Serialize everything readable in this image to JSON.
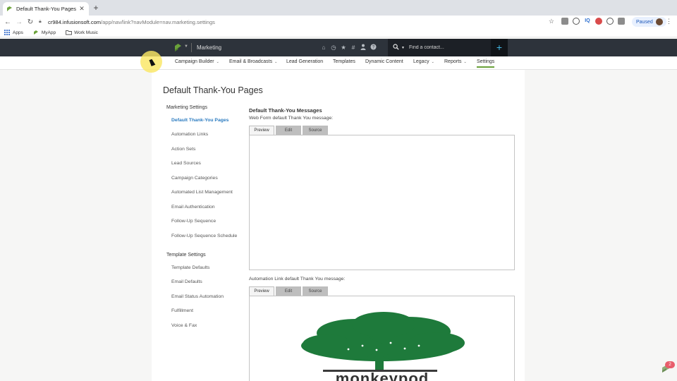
{
  "browser": {
    "tab_title": "Default Thank-You Pages",
    "new_tab_symbol": "+",
    "url_host": "cr984.infusionsoft.com",
    "url_path": "/app/nav/link?navModule=nav.marketing.settings",
    "profile_label": "Paused",
    "bookmarks": [
      "Apps",
      "MyApp",
      "Work Music"
    ]
  },
  "app": {
    "module_name": "Marketing",
    "search_placeholder": "Find a contact...",
    "plus_symbol": "+",
    "nav": [
      {
        "label": "Campaign Builder",
        "has_menu": true
      },
      {
        "label": "Email & Broadcasts",
        "has_menu": true
      },
      {
        "label": "Lead Generation",
        "has_menu": false
      },
      {
        "label": "Templates",
        "has_menu": false
      },
      {
        "label": "Dynamic Content",
        "has_menu": false
      },
      {
        "label": "Legacy",
        "has_menu": true
      },
      {
        "label": "Reports",
        "has_menu": true
      },
      {
        "label": "Settings",
        "has_menu": false,
        "active": true
      }
    ]
  },
  "page": {
    "title": "Default Thank-You Pages",
    "marketing_settings": {
      "heading": "Marketing Settings",
      "items": [
        "Default Thank-You Pages",
        "Automation Links",
        "Action Sets",
        "Lead Sources",
        "Campaign Categories",
        "Automated List Management",
        "Email Authentication",
        "Follow-Up Sequence",
        "Follow-Up Sequence Schedule"
      ]
    },
    "template_settings": {
      "heading": "Template Settings",
      "items": [
        "Template Defaults",
        "Email Defaults",
        "Email Status Automation",
        "Fulfillment",
        "Voice & Fax"
      ]
    },
    "messages_heading": "Default Thank-You Messages",
    "web_form_label": "Web Form default Thank You message:",
    "automation_label": "Automation Link default Thank You message:",
    "editor_tabs": [
      "Preview",
      "Edit",
      "Source"
    ],
    "logo_text": "monkeypod"
  },
  "chat_badge_count": "2",
  "colors": {
    "appbar": "#2d333b",
    "accent_green": "#6aa23a",
    "link_blue": "#2b7bc0",
    "logo_green": "#1e7a3b"
  }
}
